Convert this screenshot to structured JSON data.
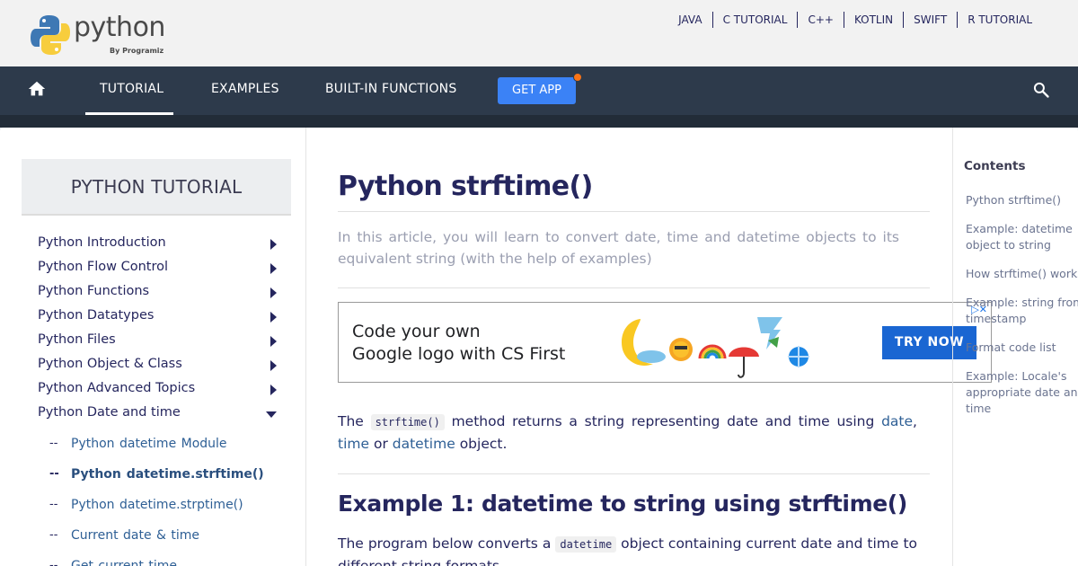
{
  "brand": {
    "name": "python",
    "sub": "By Programiz"
  },
  "top_links": [
    "JAVA",
    "C TUTORIAL",
    "C++",
    "KOTLIN",
    "SWIFT",
    "R TUTORIAL"
  ],
  "nav": {
    "items": [
      "TUTORIAL",
      "EXAMPLES",
      "BUILT-IN FUNCTIONS"
    ],
    "get_app": "GET APP"
  },
  "sidebar": {
    "title": "PYTHON TUTORIAL",
    "items": [
      "Python Introduction",
      "Python Flow Control",
      "Python Functions",
      "Python Datatypes",
      "Python Files",
      "Python Object & Class",
      "Python Advanced Topics",
      "Python Date and time"
    ],
    "sub_items": [
      "Python datetime Module",
      "Python datetime.strftime()",
      "Python datetime.strptime()",
      "Current date & time",
      "Get current time"
    ]
  },
  "article": {
    "title": "Python strftime()",
    "intro": "In this article, you will learn to convert date, time and datetime objects to its equivalent string (with the help of examples)",
    "ad": {
      "line1": "Code your own",
      "line2": "Google logo with CS First",
      "button": "TRY NOW",
      "close": "▷✕"
    },
    "p1": {
      "t1": "The",
      "code": "strftime()",
      "t2": "method returns a string representing date and time using",
      "link1": "date",
      "t3": ",",
      "link2": "time",
      "t4": "or",
      "link3": "datetime",
      "t5": "object."
    },
    "h2": "Example 1: datetime to string using strftime()",
    "p2": {
      "t1": "The program below converts a",
      "code": "datetime",
      "t2": "object containing current date and time to different string formats."
    }
  },
  "contents": {
    "title": "Contents",
    "items": [
      "Python strftime()",
      "Example: datetime object to string",
      "How strftime() works?",
      "Example: string from timestamp",
      "Format code list",
      "Example: Locale's appropriate date and time"
    ]
  },
  "colors": {
    "nav_bg": "#2d3a4b",
    "accent_blue": "#3b82f6",
    "badge": "#f97316",
    "ad_button": "#1a66d2"
  }
}
